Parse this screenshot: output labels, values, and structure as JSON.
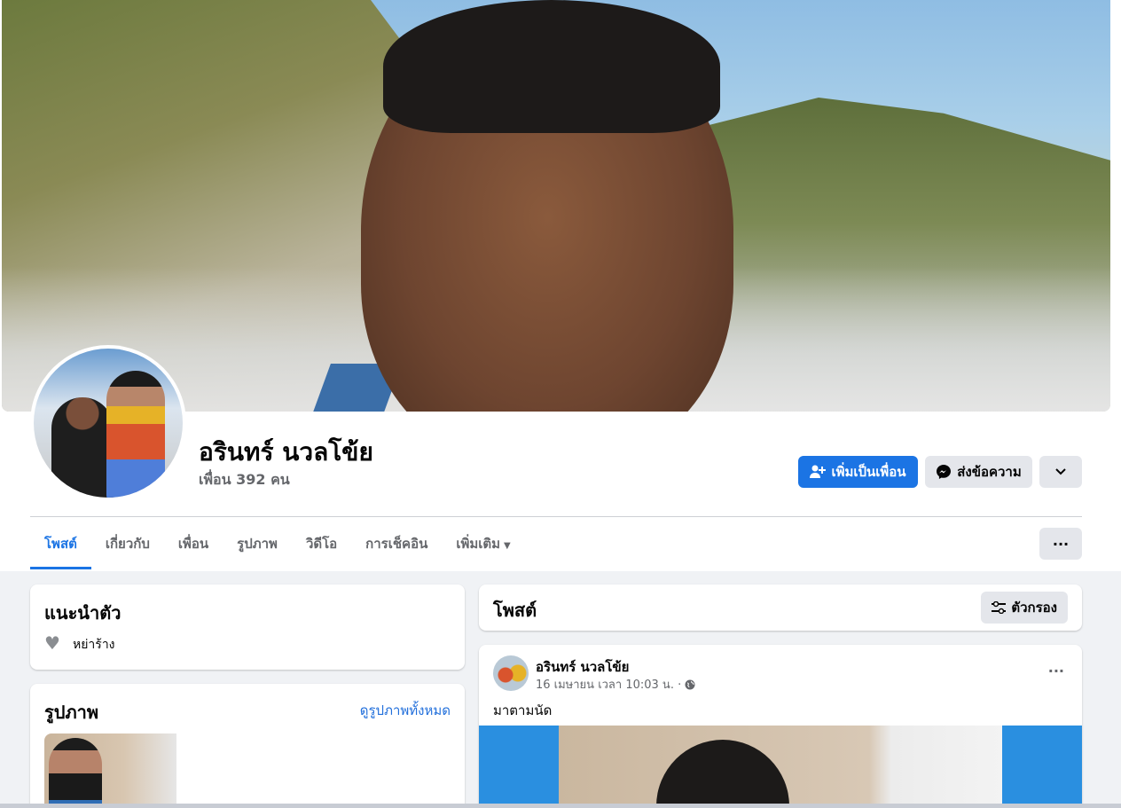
{
  "profile": {
    "name": "อรินทร์ นวลโข้ย",
    "friends_count": "เพื่อน 392 คน"
  },
  "actions": {
    "add_friend_label": "เพิ่มเป็นเพื่อน",
    "message_label": "ส่งข้อความ"
  },
  "tabs": [
    {
      "label": "โพสต์"
    },
    {
      "label": "เกี่ยวกับ"
    },
    {
      "label": "เพื่อน"
    },
    {
      "label": "รูปภาพ"
    },
    {
      "label": "วิดีโอ"
    },
    {
      "label": "การเช็คอิน"
    },
    {
      "label": "เพิ่มเติม"
    }
  ],
  "intro": {
    "title": "แนะนำตัว",
    "relationship": "หย่าร้าง"
  },
  "photos": {
    "title": "รูปภาพ",
    "see_all": "ดูรูปภาพทั้งหมด"
  },
  "posts_header": {
    "title": "โพสต์",
    "filter_label": "ตัวกรอง"
  },
  "post": {
    "author": "อรินทร์ นวลโข้ย",
    "time": "16 เมษายน เวลา 10:03 น. ·",
    "text": "มาตามนัด"
  },
  "colors": {
    "primary": "#1b74e4",
    "secondary_button": "#e4e6eb",
    "page_background": "#f0f2f5",
    "muted_text": "#65676b"
  },
  "icons": [
    "add-friend-icon",
    "messenger-icon",
    "chevron-down-icon",
    "more-icon",
    "heart-icon",
    "filter-icon",
    "globe-icon"
  ]
}
